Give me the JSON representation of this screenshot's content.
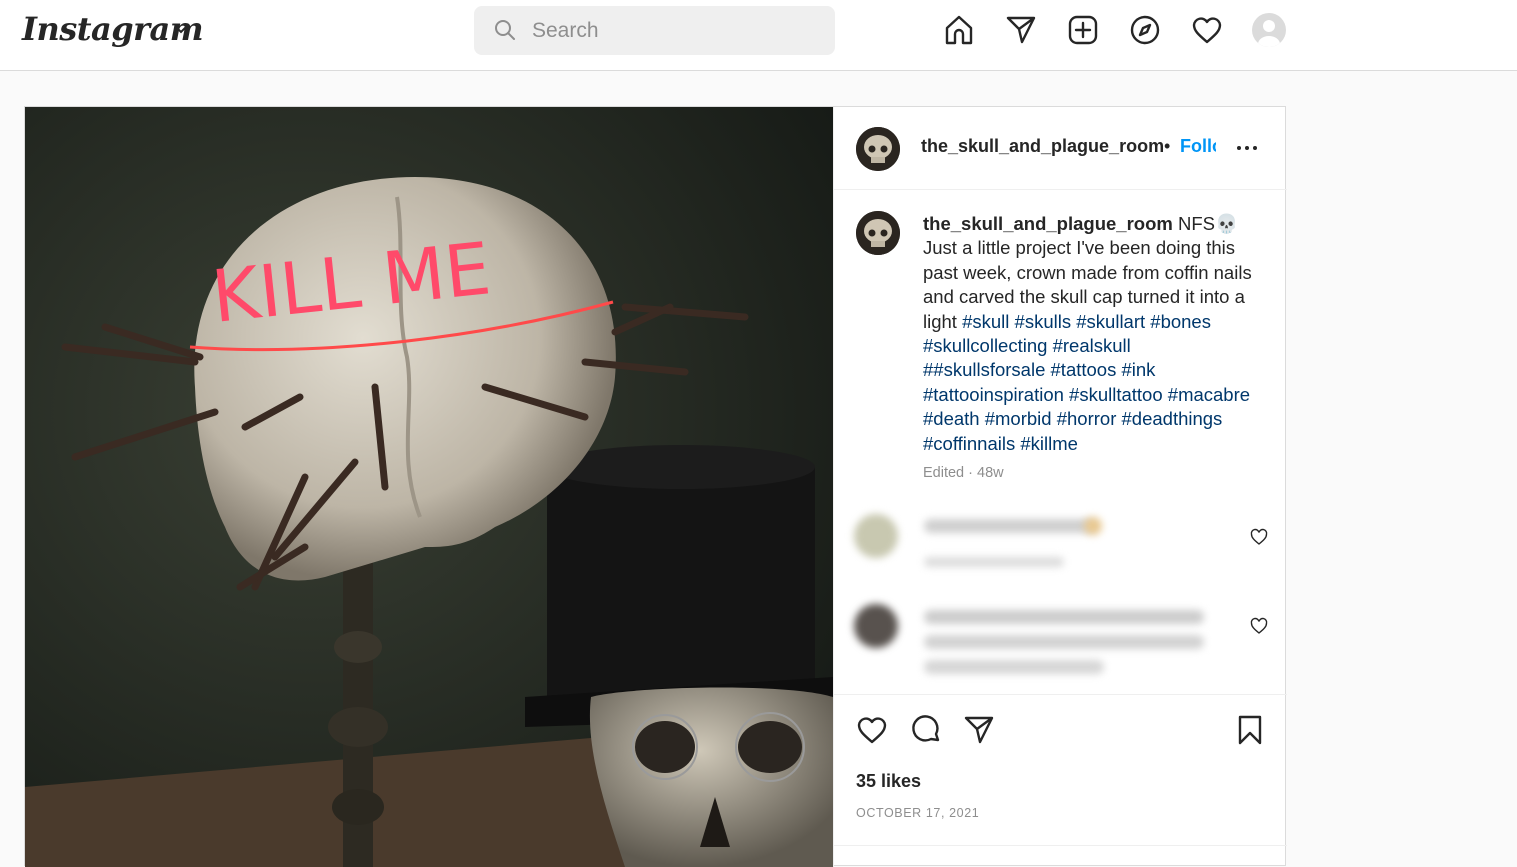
{
  "header": {
    "logo_text": "Instagram",
    "search_placeholder": "Search",
    "nav_icons": [
      "home-icon",
      "direct-icon",
      "new-post-icon",
      "explore-icon",
      "activity-icon",
      "profile-avatar"
    ]
  },
  "post": {
    "username": "the_skull_and_plague_room",
    "separator": "•",
    "follow_label": "Follow",
    "photo_text": "KILL ME",
    "caption": {
      "username": "the_skull_and_plague_room",
      "text": "NFS💀 Just a little project I've been doing this past week, crown made from coffin nails and carved the skull cap turned it into a light",
      "hashtags": [
        "#skull",
        "#skulls",
        "#skullart",
        "#bones",
        "#skullcollecting",
        "#realskull",
        "##skullsforsale",
        "#tattoos",
        "#ink",
        "#tattooinspiration",
        "#skulltattoo",
        "#macabre",
        "#death",
        "#morbid",
        "#horror",
        "#deadthings",
        "#coffinnails",
        "#killme"
      ]
    },
    "edited": "Edited · 48w",
    "likes": "35 likes",
    "date": "OCTOBER 17, 2021"
  },
  "colors": {
    "link": "#00376b",
    "follow": "#0095f6",
    "muted": "#8e8e8e",
    "text": "#262626",
    "border": "#dbdbdb"
  }
}
